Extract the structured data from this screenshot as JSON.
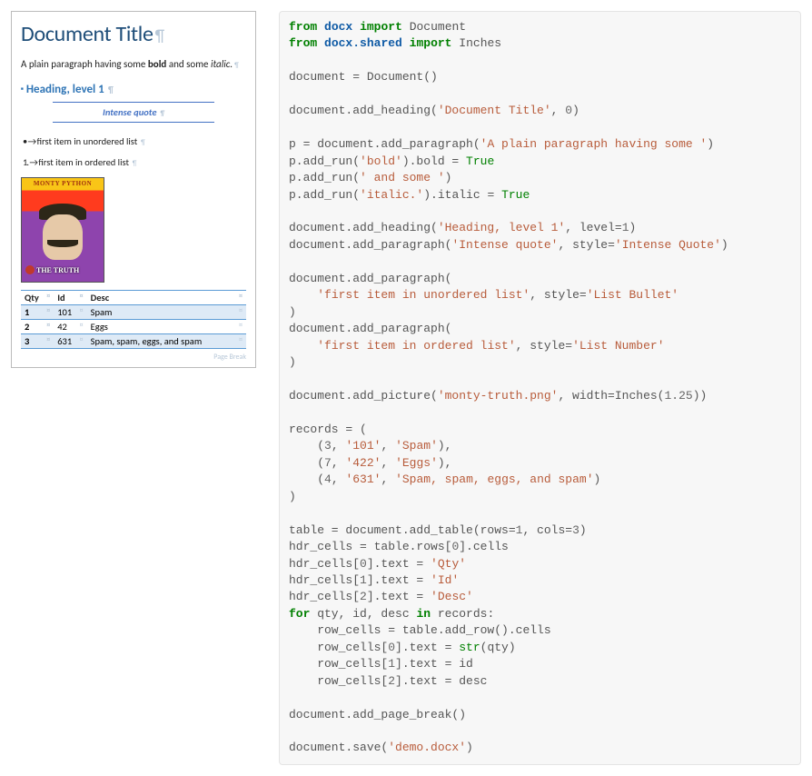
{
  "doc": {
    "title": "Document Title",
    "plain": {
      "pre": "A plain paragraph having some ",
      "bold": "bold",
      "mid": " and some ",
      "italic": "italic."
    },
    "heading1": "Heading, level 1",
    "intense_quote": "Intense quote",
    "ul_item": "first item in unordered list",
    "ol_item": "first item in ordered list",
    "image_top": "MONTY PYTHON",
    "image_bottom": "THE TRUTH",
    "table": {
      "headers": [
        "Qty",
        "Id",
        "Desc"
      ],
      "rows": [
        [
          "1",
          "101",
          "Spam"
        ],
        [
          "2",
          "42",
          "Eggs"
        ],
        [
          "3",
          "631",
          "Spam, spam, eggs, and spam"
        ]
      ]
    },
    "page_break": "Page Break"
  },
  "code": {
    "l01_from": "from",
    "l01_mod": "docx",
    "l01_imp": "import",
    "l01_name": "Document",
    "l02_from": "from",
    "l02_mod": "docx.shared",
    "l02_imp": "import",
    "l02_name": "Inches",
    "l04": "document = Document()",
    "l06_a": "document.add_heading(",
    "l06_s": "'Document Title'",
    "l06_b": ", ",
    "l06_n": "0",
    "l06_c": ")",
    "l08_a": "p = document.add_paragraph(",
    "l08_s": "'A plain paragraph having some '",
    "l08_b": ")",
    "l09_a": "p.add_run(",
    "l09_s": "'bold'",
    "l09_b": ").bold = ",
    "l09_t": "True",
    "l10_a": "p.add_run(",
    "l10_s": "' and some '",
    "l10_b": ")",
    "l11_a": "p.add_run(",
    "l11_s": "'italic.'",
    "l11_b": ").italic = ",
    "l11_t": "True",
    "l13_a": "document.add_heading(",
    "l13_s": "'Heading, level 1'",
    "l13_b": ", level=",
    "l13_n": "1",
    "l13_c": ")",
    "l14_a": "document.add_paragraph(",
    "l14_s": "'Intense quote'",
    "l14_b": ", style=",
    "l14_s2": "'Intense Quote'",
    "l14_c": ")",
    "l16": "document.add_paragraph(",
    "l17_s": "'first item in unordered list'",
    "l17_b": ", style=",
    "l17_s2": "'List Bullet'",
    "l18": ")",
    "l19": "document.add_paragraph(",
    "l20_s": "'first item in ordered list'",
    "l20_b": ", style=",
    "l20_s2": "'List Number'",
    "l21": ")",
    "l23_a": "document.add_picture(",
    "l23_s": "'monty-truth.png'",
    "l23_b": ", width=Inches(",
    "l23_n": "1.25",
    "l23_c": "))",
    "l25": "records = (",
    "l26_a": "    (",
    "l26_n": "3",
    "l26_b": ", ",
    "l26_s1": "'101'",
    "l26_c": ", ",
    "l26_s2": "'Spam'",
    "l26_d": "),",
    "l27_a": "    (",
    "l27_n": "7",
    "l27_b": ", ",
    "l27_s1": "'422'",
    "l27_c": ", ",
    "l27_s2": "'Eggs'",
    "l27_d": "),",
    "l28_a": "    (",
    "l28_n": "4",
    "l28_b": ", ",
    "l28_s1": "'631'",
    "l28_c": ", ",
    "l28_s2": "'Spam, spam, eggs, and spam'",
    "l28_d": ")",
    "l29": ")",
    "l31_a": "table = document.add_table(rows=",
    "l31_n1": "1",
    "l31_b": ", cols=",
    "l31_n2": "3",
    "l31_c": ")",
    "l32_a": "hdr_cells = table.rows[",
    "l32_n": "0",
    "l32_b": "].cells",
    "l33_a": "hdr_cells[",
    "l33_n": "0",
    "l33_b": "].text = ",
    "l33_s": "'Qty'",
    "l34_a": "hdr_cells[",
    "l34_n": "1",
    "l34_b": "].text = ",
    "l34_s": "'Id'",
    "l35_a": "hdr_cells[",
    "l35_n": "2",
    "l35_b": "].text = ",
    "l35_s": "'Desc'",
    "l36_for": "for",
    "l36_a": " qty, id, desc ",
    "l36_in": "in",
    "l36_b": " records:",
    "l37": "    row_cells = table.add_row().cells",
    "l38_a": "    row_cells[",
    "l38_n": "0",
    "l38_b": "].text = ",
    "l38_fn": "str",
    "l38_c": "(qty)",
    "l39_a": "    row_cells[",
    "l39_n": "1",
    "l39_b": "].text = id",
    "l40_a": "    row_cells[",
    "l40_n": "2",
    "l40_b": "].text = desc",
    "l42": "document.add_page_break()",
    "l44_a": "document.save(",
    "l44_s": "'demo.docx'",
    "l44_b": ")"
  }
}
